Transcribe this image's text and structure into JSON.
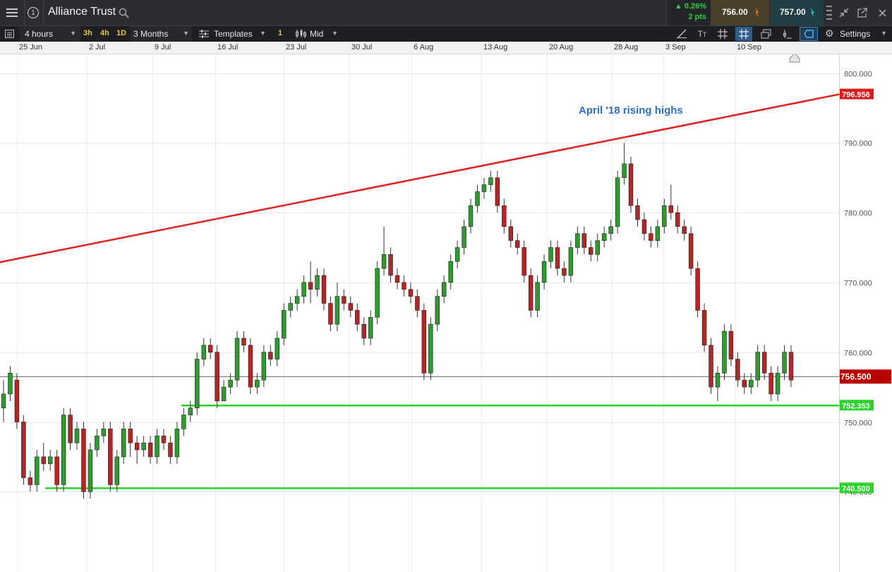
{
  "app": {
    "instrument": "Alliance Trust",
    "change_pct": "0.26%",
    "change_pts": "2 pts",
    "sell_price": "756.00",
    "buy_price": "757.00",
    "info_icon_text": "1",
    "colors": {
      "up": "#1bbf2a",
      "down": "#e8762b",
      "buy_accent": "#1fc5d0",
      "sell_bg": "#4a3f2b",
      "buy_bg": "#213e44"
    }
  },
  "toolbar": {
    "interval": "4 hours",
    "quick_3h": "3h",
    "quick_4h": "4h",
    "quick_1d": "1D",
    "period": "3 Months",
    "templates": "Templates",
    "badge": "1",
    "price_type": "Mid",
    "settings": "Settings",
    "tools": [
      "line-draw",
      "text",
      "grid",
      "crosshair",
      "layers",
      "indicator",
      "shape"
    ]
  },
  "dates": [
    "25 Jun",
    "2 Jul",
    "9 Jul",
    "16 Jul",
    "23 Jul",
    "30 Jul",
    "6 Aug",
    "13 Aug",
    "20 Aug",
    "28 Aug",
    "3 Sep",
    "10 Sep"
  ],
  "chart_data": {
    "type": "candlestick",
    "title": "",
    "y_ticks": [
      "800.000",
      "790.000",
      "780.000",
      "770.000",
      "760.000",
      "750.000",
      "740.000"
    ],
    "ylim": [
      731.4,
      803.6
    ],
    "grid": true,
    "current_price": "756.500",
    "annotation": "April '18 rising highs",
    "trendline": {
      "label": "796.956",
      "color": "#e02020",
      "y_start": 772.9,
      "y_end": 796.956
    },
    "support_lines": [
      {
        "label": "752.353",
        "value": 752.353,
        "color": "#2fd12f"
      },
      {
        "label": "740.500",
        "value": 740.5,
        "color": "#2fd12f"
      }
    ],
    "candles": [
      [
        752,
        754,
        750,
        756
      ],
      [
        754,
        757,
        753,
        758
      ],
      [
        756,
        750,
        749,
        757
      ],
      [
        750,
        742,
        741,
        751
      ],
      [
        742,
        741,
        740,
        743
      ],
      [
        741,
        745,
        740,
        746
      ],
      [
        745,
        744,
        743,
        747
      ],
      [
        744,
        745,
        743,
        746
      ],
      [
        745,
        741,
        740,
        746
      ],
      [
        741,
        751,
        740,
        752
      ],
      [
        751,
        747,
        746,
        752
      ],
      [
        747,
        749,
        746,
        750
      ],
      [
        749,
        740,
        739,
        750
      ],
      [
        740,
        746,
        739,
        747
      ],
      [
        746,
        748,
        745,
        749
      ],
      [
        748,
        749,
        747,
        750
      ],
      [
        749,
        741,
        740,
        750
      ],
      [
        741,
        745,
        740,
        746
      ],
      [
        745,
        749,
        744,
        750
      ],
      [
        749,
        747,
        745,
        750
      ],
      [
        747,
        746,
        744,
        748
      ],
      [
        746,
        747,
        745,
        748
      ],
      [
        747,
        745,
        744,
        748
      ],
      [
        745,
        748,
        744,
        749
      ],
      [
        748,
        747,
        746,
        749
      ],
      [
        747,
        745,
        744,
        748
      ],
      [
        745,
        749,
        744,
        750
      ],
      [
        749,
        751,
        748,
        752
      ],
      [
        751,
        752,
        750,
        753
      ],
      [
        752,
        759,
        751,
        760
      ],
      [
        759,
        761,
        758,
        762
      ],
      [
        761,
        760,
        759,
        762
      ],
      [
        760,
        753,
        752,
        761
      ],
      [
        753,
        755,
        753,
        756
      ],
      [
        755,
        756,
        754,
        757
      ],
      [
        756,
        762,
        755,
        763
      ],
      [
        762,
        761,
        760,
        763
      ],
      [
        761,
        755,
        754,
        762
      ],
      [
        755,
        756,
        754,
        757
      ],
      [
        756,
        760,
        755,
        761
      ],
      [
        760,
        759,
        758,
        761
      ],
      [
        759,
        762,
        758,
        763
      ],
      [
        762,
        766,
        761,
        767
      ],
      [
        766,
        767,
        765,
        768
      ],
      [
        767,
        768,
        766,
        769
      ],
      [
        768,
        770,
        767,
        771
      ],
      [
        770,
        769,
        767,
        773
      ],
      [
        769,
        771,
        768,
        772
      ],
      [
        771,
        767,
        766,
        772
      ],
      [
        767,
        764,
        763,
        768
      ],
      [
        764,
        768,
        763,
        770
      ],
      [
        768,
        767,
        766,
        769
      ],
      [
        767,
        766,
        765,
        768
      ],
      [
        766,
        764,
        763,
        767
      ],
      [
        764,
        762,
        761,
        765
      ],
      [
        762,
        765,
        761,
        766
      ],
      [
        765,
        772,
        764,
        773
      ],
      [
        772,
        774,
        771,
        778
      ],
      [
        774,
        771,
        770,
        775
      ],
      [
        771,
        770,
        769,
        772
      ],
      [
        770,
        769,
        768,
        771
      ],
      [
        769,
        768,
        767,
        770
      ],
      [
        768,
        766,
        765,
        769
      ],
      [
        766,
        757,
        756,
        767
      ],
      [
        757,
        764,
        756,
        765
      ],
      [
        764,
        768,
        763,
        769
      ],
      [
        768,
        770,
        767,
        771
      ],
      [
        770,
        773,
        769,
        774
      ],
      [
        773,
        775,
        772,
        776
      ],
      [
        775,
        778,
        774,
        779
      ],
      [
        778,
        781,
        777,
        782
      ],
      [
        781,
        783,
        780,
        784
      ],
      [
        783,
        784,
        782,
        785
      ],
      [
        784,
        785,
        783,
        786
      ],
      [
        785,
        781,
        780,
        786
      ],
      [
        781,
        778,
        777,
        782
      ],
      [
        778,
        776,
        775,
        779
      ],
      [
        776,
        775,
        774,
        777
      ],
      [
        775,
        771,
        770,
        776
      ],
      [
        771,
        766,
        765,
        772
      ],
      [
        766,
        770,
        765,
        771
      ],
      [
        770,
        773,
        769,
        774
      ],
      [
        773,
        775,
        772,
        776
      ],
      [
        775,
        772,
        771,
        776
      ],
      [
        772,
        771,
        770,
        773
      ],
      [
        771,
        775,
        770,
        776
      ],
      [
        775,
        777,
        774,
        778
      ],
      [
        777,
        775,
        774,
        778
      ],
      [
        775,
        774,
        773,
        776
      ],
      [
        774,
        776,
        773,
        777
      ],
      [
        776,
        777,
        775,
        778
      ],
      [
        777,
        778,
        776,
        779
      ],
      [
        778,
        785,
        777,
        786
      ],
      [
        785,
        787,
        784,
        790
      ],
      [
        787,
        781,
        780,
        788
      ],
      [
        781,
        779,
        778,
        782
      ],
      [
        779,
        777,
        776,
        780
      ],
      [
        777,
        776,
        775,
        778
      ],
      [
        776,
        778,
        775,
        779
      ],
      [
        778,
        781,
        777,
        782
      ],
      [
        781,
        780,
        779,
        784
      ],
      [
        780,
        778,
        777,
        781
      ],
      [
        778,
        777,
        776,
        779
      ],
      [
        777,
        772,
        771,
        778
      ],
      [
        772,
        766,
        765,
        773
      ],
      [
        766,
        761,
        760,
        767
      ],
      [
        761,
        755,
        754,
        762
      ],
      [
        755,
        757,
        753,
        758
      ],
      [
        757,
        763,
        756,
        764
      ],
      [
        763,
        759,
        758,
        764
      ],
      [
        759,
        756,
        755,
        760
      ],
      [
        756,
        755,
        754,
        757
      ],
      [
        755,
        756,
        754,
        757
      ],
      [
        756,
        760,
        755,
        761
      ],
      [
        760,
        757,
        756,
        761
      ],
      [
        757,
        754,
        753,
        758
      ],
      [
        754,
        757,
        753,
        758
      ],
      [
        757,
        760,
        756,
        761
      ],
      [
        760,
        756,
        755,
        761
      ]
    ]
  }
}
